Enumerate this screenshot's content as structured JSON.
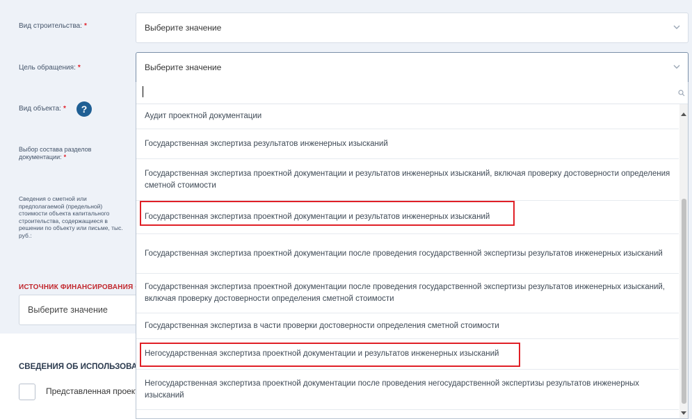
{
  "labels": {
    "construction_type": "Вид строительства:",
    "appeal_purpose": "Цель обращения:",
    "object_type": "Вид объекта:",
    "sections_choice": "Выбор состава разделов документации:",
    "estimate_info": "Сведения о сметной или предполагаемой (предельной) стоимости объекта капитального строительства, содержащиеся в решении по объекту или письме, тыс. руб.:",
    "required_mark": "*"
  },
  "help_icon": "?",
  "funding": {
    "title": "ИСТОЧНИК ФИНАНСИРОВАНИЯ",
    "required_mark": "•",
    "placeholder": "Выберите значение"
  },
  "usage": {
    "title": "СВЕДЕНИЯ ОБ ИСПОЛЬЗОВАНИИ",
    "checkbox_label": "Представленная проект"
  },
  "construction_select": {
    "value": "Выберите значение"
  },
  "purpose_select": {
    "value": "Выберите значение"
  },
  "dropdown": {
    "search_value": "",
    "options": [
      "Аудит проектной документации",
      "Государственная экспертиза результатов инженерных изысканий",
      "Государственная экспертиза проектной документации и результатов инженерных изысканий, включая проверку достоверности определения сметной стоимости",
      "Государственная экспертиза проектной документации и результатов инженерных изысканий",
      "Государственная экспертиза проектной документации после проведения государственной экспертизы результатов инженерных изысканий",
      "Государственная экспертиза проектной документации после проведения государственной экспертизы результатов инженерных изысканий, включая проверку достоверности определения сметной стоимости",
      "Государственная экспертиза в части проверки достоверности определения сметной стоимости",
      "Негосударственная экспертиза проектной документации и результатов инженерных изысканий",
      "Негосударственная экспертиза проектной документации после проведения негосударственной экспертизы результатов инженерных изысканий"
    ]
  },
  "colors": {
    "highlight": "#e01f26",
    "form_bg": "#eef2f8",
    "required": "#e0202a",
    "help": "#1f5f94"
  }
}
